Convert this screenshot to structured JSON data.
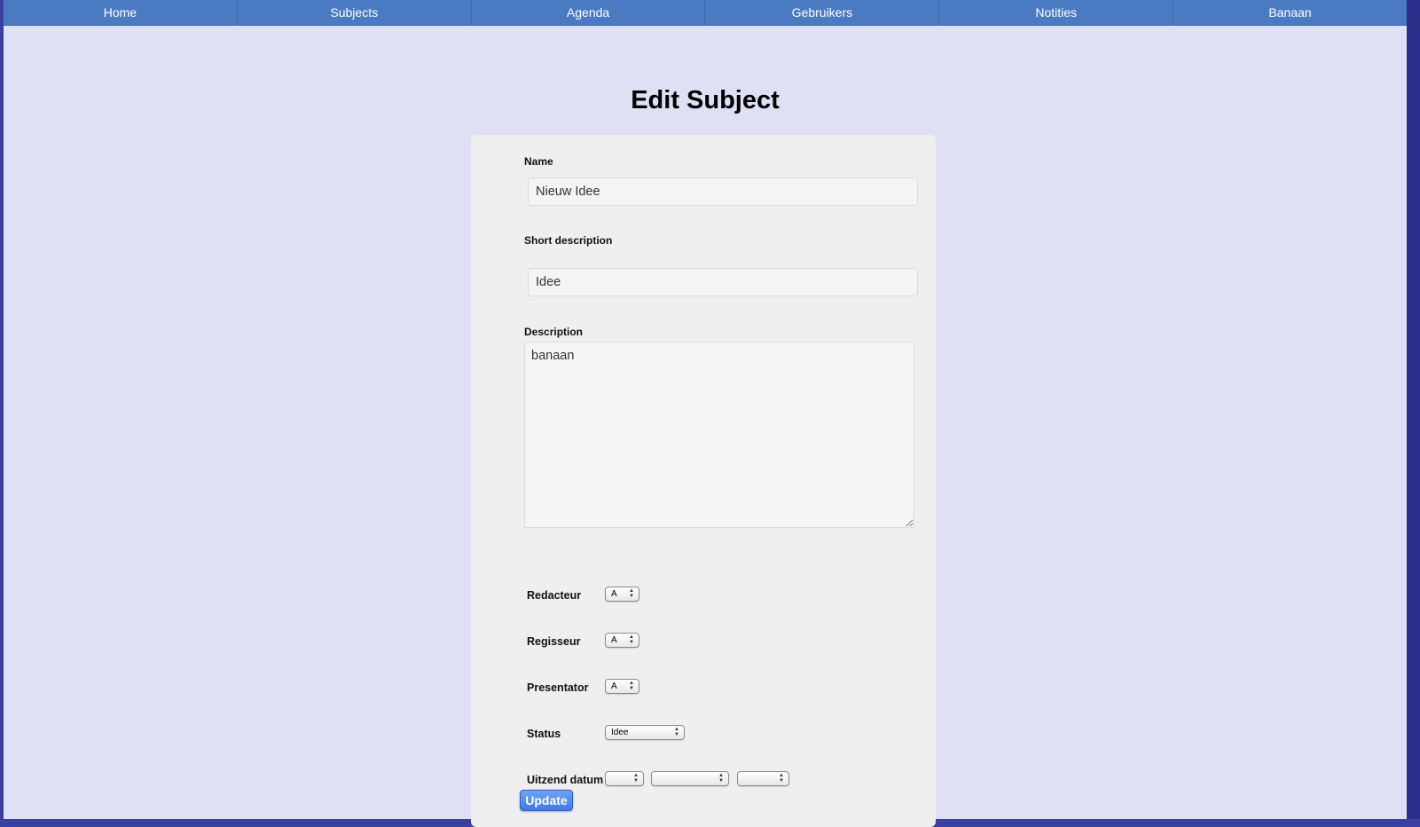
{
  "nav": {
    "items": [
      {
        "label": "Home"
      },
      {
        "label": "Subjects"
      },
      {
        "label": "Agenda"
      },
      {
        "label": "Gebruikers"
      },
      {
        "label": "Notities"
      },
      {
        "label": "Banaan"
      }
    ]
  },
  "page": {
    "title": "Edit Subject"
  },
  "form": {
    "name": {
      "label": "Name",
      "value": "Nieuw Idee"
    },
    "short_description": {
      "label": "Short description",
      "value": "Idee"
    },
    "description": {
      "label": "Description",
      "value": "banaan"
    },
    "redacteur": {
      "label": "Redacteur",
      "selected": "A"
    },
    "regisseur": {
      "label": "Regisseur",
      "selected": "A"
    },
    "presentator": {
      "label": "Presentator",
      "selected": "A"
    },
    "status": {
      "label": "Status",
      "selected": "Idee"
    },
    "uitzend_datum": {
      "label": "Uitzend datum",
      "day": "",
      "month": "",
      "year": ""
    },
    "submit_label": "Update"
  },
  "colors": {
    "nav_bg": "#4a7bc2",
    "page_bg": "#dfe0f4",
    "panel_bg": "#efefef",
    "button": "#3c7ae6"
  }
}
